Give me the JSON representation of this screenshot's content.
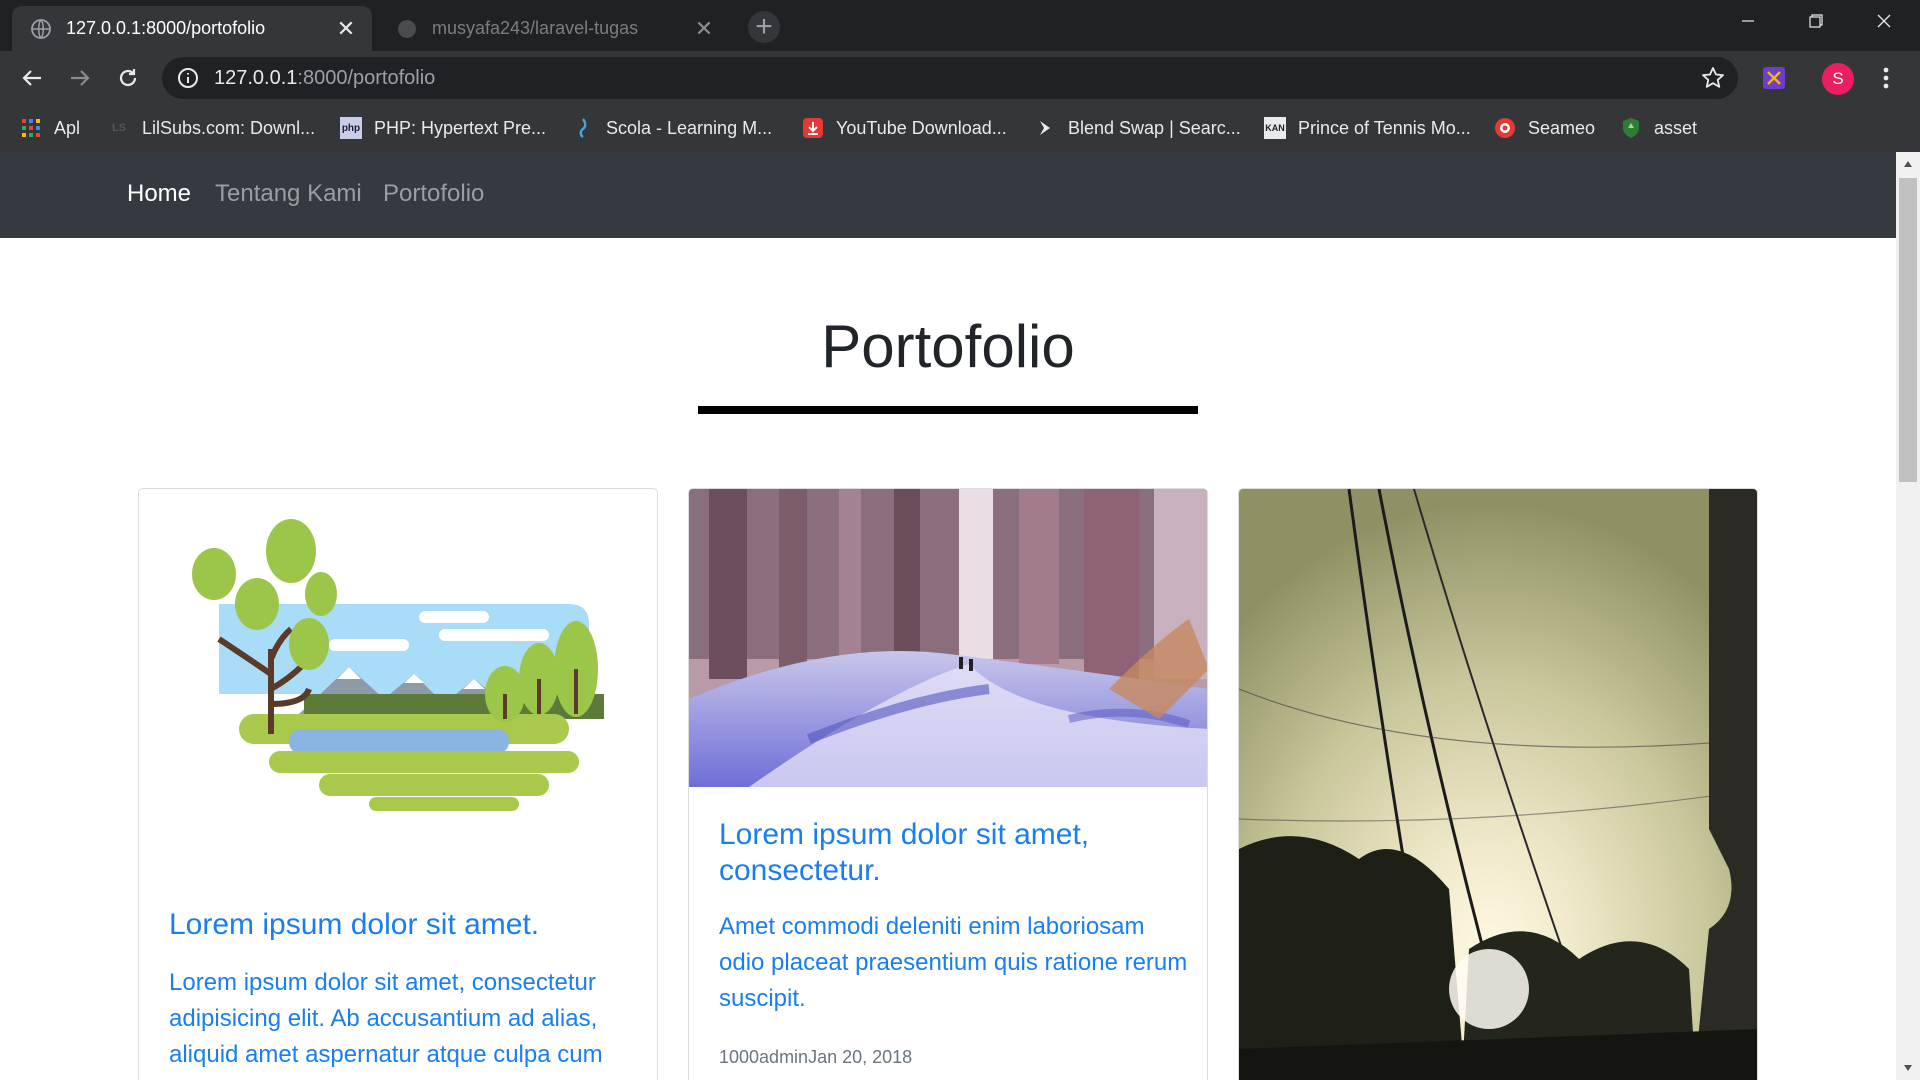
{
  "browser": {
    "tabs": [
      {
        "title": "127.0.0.1:8000/portofolio",
        "active": true
      },
      {
        "title": "musyafa243/laravel-tugas",
        "active": false
      }
    ],
    "close_glyph": "✕",
    "new_tab_glyph": "+",
    "address": {
      "host": "127.0.0.1",
      "rest": ":8000/portofolio"
    },
    "profile_initial": "S",
    "bookmarks": [
      {
        "label": "Apl",
        "icon": "apps-grid-icon"
      },
      {
        "label": "LilSubs.com: Downl...",
        "icon": "lilsubs-icon",
        "icon_text": "LS"
      },
      {
        "label": "PHP: Hypertext Pre...",
        "icon": "php-icon",
        "icon_text": "php"
      },
      {
        "label": "Scola - Learning M...",
        "icon": "scola-icon"
      },
      {
        "label": "YouTube Download...",
        "icon": "youtube-download-icon"
      },
      {
        "label": "Blend Swap | Searc...",
        "icon": "blend-swap-icon"
      },
      {
        "label": "Prince of Tennis Mo...",
        "icon": "kantai-icon",
        "icon_text": "KAN"
      },
      {
        "label": "Seameo",
        "icon": "seameo-icon"
      },
      {
        "label": "asset",
        "icon": "asset-icon"
      }
    ]
  },
  "site": {
    "nav": [
      {
        "label": "Home",
        "active": true
      },
      {
        "label": "Tentang Kami",
        "active": false
      },
      {
        "label": "Portofolio",
        "active": false
      }
    ],
    "page_title": "Portofolio",
    "cards": [
      {
        "image": "flat-landscape-illustration",
        "title": "Lorem ipsum dolor sit amet.",
        "text": "Lorem ipsum dolor sit amet, consectetur adipisicing elit. Ab accusantium ad alias, aliquid amet aspernatur atque culpa cum"
      },
      {
        "image": "snowy-forest-painting",
        "title": "Lorem ipsum dolor sit amet, consectetur.",
        "text": "Amet commodi deleniti enim laboriosam odio placeat praesentium quis ratione rerum suscipit.",
        "meta": "1000adminJan 20, 2018"
      },
      {
        "image": "sunset-power-lines-photo"
      }
    ]
  },
  "colors": {
    "chrome_dark": "#202124",
    "chrome": "#35363a",
    "site_nav": "#343a40",
    "link_blue": "#1a7ef0"
  }
}
